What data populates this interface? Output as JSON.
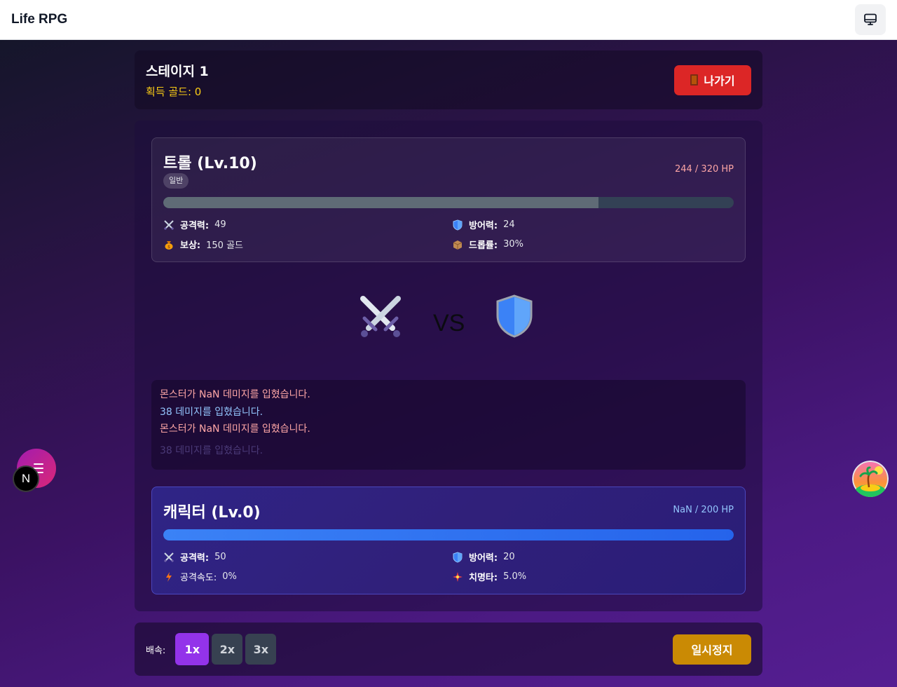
{
  "app": {
    "title": "Life RPG"
  },
  "header": {
    "stage_title": "스테이지 1",
    "gold_label": "획득 골드: 0",
    "exit_label": "나가기"
  },
  "monster": {
    "name": "트롤 (Lv.10)",
    "tier": "일반",
    "hp_text": "244 / 320 HP",
    "hp_fraction": 0.7625,
    "stats": [
      {
        "icon": "crossed-swords-icon",
        "label": "공격력:",
        "value": "49"
      },
      {
        "icon": "shield-icon",
        "label": "방어력:",
        "value": "24"
      },
      {
        "icon": "money-bag-icon",
        "label": "보상:",
        "value": "150 골드"
      },
      {
        "icon": "package-icon",
        "label": "드롭률:",
        "value": "30%"
      }
    ]
  },
  "battle": {
    "vs_text": "VS"
  },
  "log": [
    {
      "text": "몬스터가 NaN 데미지를 입혔습니다.",
      "color": "#fca5a5"
    },
    {
      "text": "38 데미지를 입혔습니다.",
      "color": "#93c5fd"
    },
    {
      "text": "몬스터가 NaN 데미지를 입혔습니다.",
      "color": "#fca5a5"
    },
    {
      "text": "38 데미지를 입혔습니다.",
      "color": "#4b3a78"
    }
  ],
  "character": {
    "name": "캐릭터 (Lv.0)",
    "hp_text": "NaN / 200 HP",
    "hp_fraction": 1.0,
    "stats": [
      {
        "icon": "crossed-swords-icon",
        "label": "공격력:",
        "value": "50"
      },
      {
        "icon": "shield-icon",
        "label": "방어력:",
        "value": "20"
      },
      {
        "icon": "lightning-icon",
        "label": "공격속도:",
        "value": "0%"
      },
      {
        "icon": "sparkle-icon",
        "label": "치명타:",
        "value": "5.0%"
      }
    ]
  },
  "speed": {
    "label": "배속:",
    "options": [
      "1x",
      "2x",
      "3x"
    ],
    "selected": "1x",
    "pause_label": "일시정지"
  },
  "floating": {
    "badge_letter": "N"
  },
  "colors": {
    "accent": "#9333ea",
    "exit": "#dc2626",
    "pause": "#ca8a04",
    "gold": "#facc15",
    "player_bar": "#3b82f6",
    "monster_bar": "#5f6b76"
  }
}
